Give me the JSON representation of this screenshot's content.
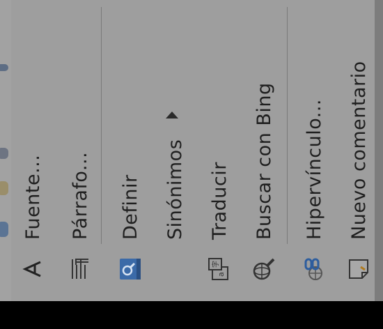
{
  "context_menu": {
    "items": [
      {
        "label": "Fuente...",
        "icon": "font-icon"
      },
      {
        "label": "Párrafo...",
        "icon": "paragraph-icon"
      },
      {
        "label": "Definir",
        "icon": "define-icon"
      },
      {
        "label": "Sinónimos",
        "icon": "synonyms-icon",
        "has_submenu": true
      },
      {
        "label": "Traducir",
        "icon": "translate-icon"
      },
      {
        "label": "Buscar con Bing",
        "icon": "search-icon"
      },
      {
        "label": "Hipervínculo...",
        "icon": "hyperlink-icon"
      },
      {
        "label": "Nuevo comentario",
        "icon": "new-comment-icon"
      }
    ]
  },
  "colors": {
    "menu_background": "#9e9e9e",
    "text": "#1f1f1f",
    "separator": "#7a7a7a",
    "define_icon": "#3b6aa8",
    "hyperlink_icon": "#2d5d9e"
  }
}
